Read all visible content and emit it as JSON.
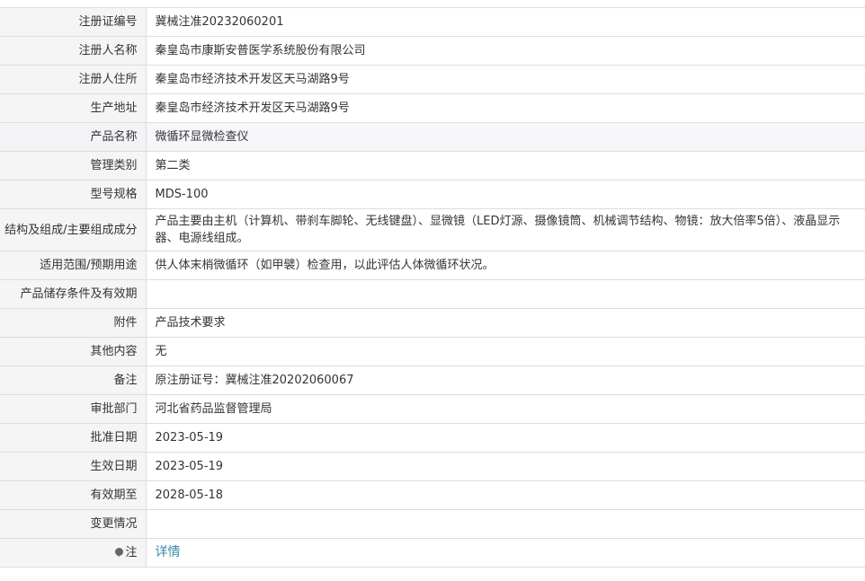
{
  "rows": [
    {
      "label": "注册证编号",
      "value": "冀械注准20232060201"
    },
    {
      "label": "注册人名称",
      "value": "秦皇岛市康斯安普医学系统股份有限公司"
    },
    {
      "label": "注册人住所",
      "value": "秦皇岛市经济技术开发区天马湖路9号"
    },
    {
      "label": "生产地址",
      "value": "秦皇岛市经济技术开发区天马湖路9号"
    },
    {
      "label": "产品名称",
      "value": "微循环显微检查仪"
    },
    {
      "label": "管理类别",
      "value": "第二类"
    },
    {
      "label": "型号规格",
      "value": "MDS-100"
    },
    {
      "label": "结构及组成/主要组成成分",
      "value": "产品主要由主机（计算机、带刹车脚轮、无线键盘）、显微镜（LED灯源、摄像镜筒、机械调节结构、物镜：放大倍率5倍）、液晶显示器、电源线组成。"
    },
    {
      "label": "适用范围/预期用途",
      "value": "供人体末梢微循环（如甲襞）检查用，以此评估人体微循环状况。"
    },
    {
      "label": "产品储存条件及有效期",
      "value": ""
    },
    {
      "label": "附件",
      "value": "产品技术要求"
    },
    {
      "label": "其他内容",
      "value": "无"
    },
    {
      "label": "备注",
      "value": "原注册证号：冀械注准20202060067"
    },
    {
      "label": "审批部门",
      "value": "河北省药品监督管理局"
    },
    {
      "label": "批准日期",
      "value": "2023-05-19"
    },
    {
      "label": "生效日期",
      "value": "2023-05-19"
    },
    {
      "label": "有效期至",
      "value": "2028-05-18"
    },
    {
      "label": "变更情况",
      "value": ""
    }
  ],
  "note": {
    "label": "注",
    "icon": "pin-icon",
    "link_text": "详情"
  },
  "colors": {
    "label_bg": "#f5f5f5",
    "highlight_bg": "#f6f6fb",
    "border": "#dddddd",
    "link": "#3a87ad"
  }
}
